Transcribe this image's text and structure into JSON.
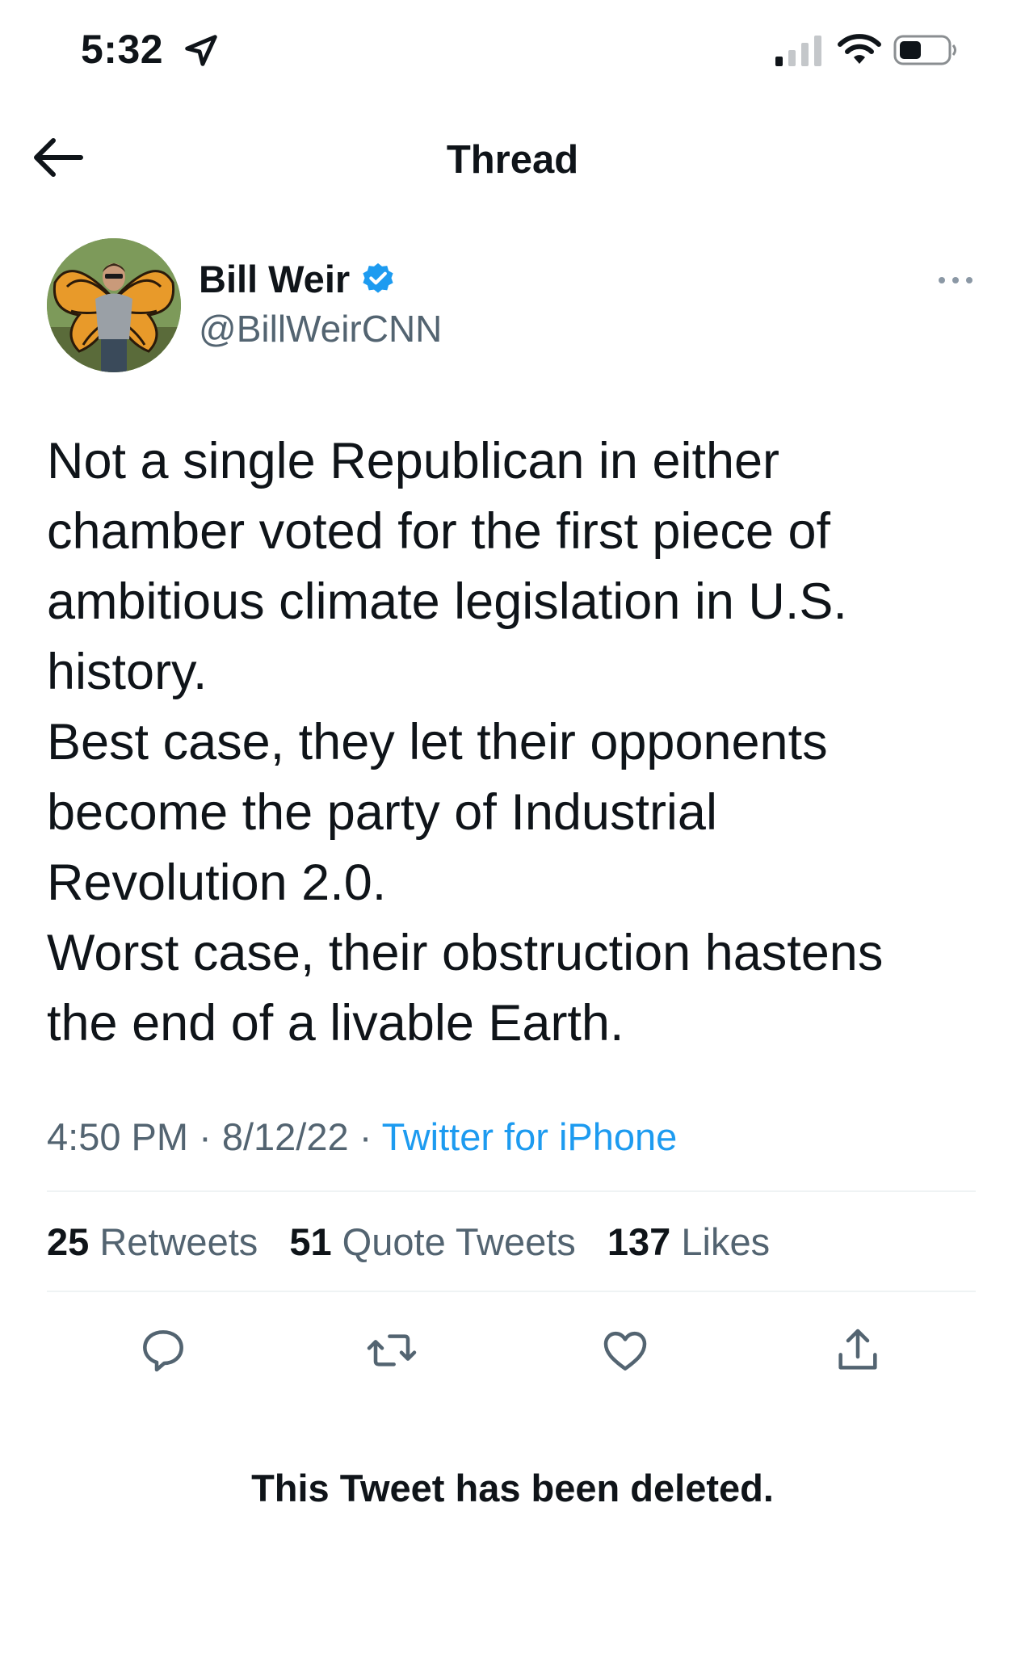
{
  "status_bar": {
    "time": "5:32",
    "icons": [
      "location-arrow-icon",
      "signal-icon",
      "wifi-icon",
      "battery-icon"
    ]
  },
  "header": {
    "title": "Thread",
    "back_icon": "back-arrow-icon"
  },
  "tweet": {
    "author_name": "Bill Weir",
    "author_handle": "@BillWeirCNN",
    "verified": true,
    "text_lines": [
      "Not a single Republican in either",
      "chamber voted for the first piece of",
      "ambitious climate legislation in U.S.",
      "history.",
      "Best case, they let their opponents",
      "become the party of Industrial",
      "Revolution 2.0.",
      "Worst case, their obstruction hastens",
      "the end of a livable Earth."
    ],
    "time": "4:50 PM",
    "date": "8/12/22",
    "separator": "·",
    "source": "Twitter for iPhone",
    "stats": {
      "retweets_count": "25",
      "retweets_label": "Retweets",
      "quotes_count": "51",
      "quotes_label": "Quote Tweets",
      "likes_count": "137",
      "likes_label": "Likes"
    },
    "actions": [
      "reply-icon",
      "retweet-icon",
      "like-icon",
      "share-icon"
    ]
  },
  "deleted_notice": "This Tweet has been deleted.",
  "colors": {
    "text": "#0f1419",
    "secondary": "#536471",
    "accent": "#1d9bf0",
    "divider": "#eff3f4"
  }
}
